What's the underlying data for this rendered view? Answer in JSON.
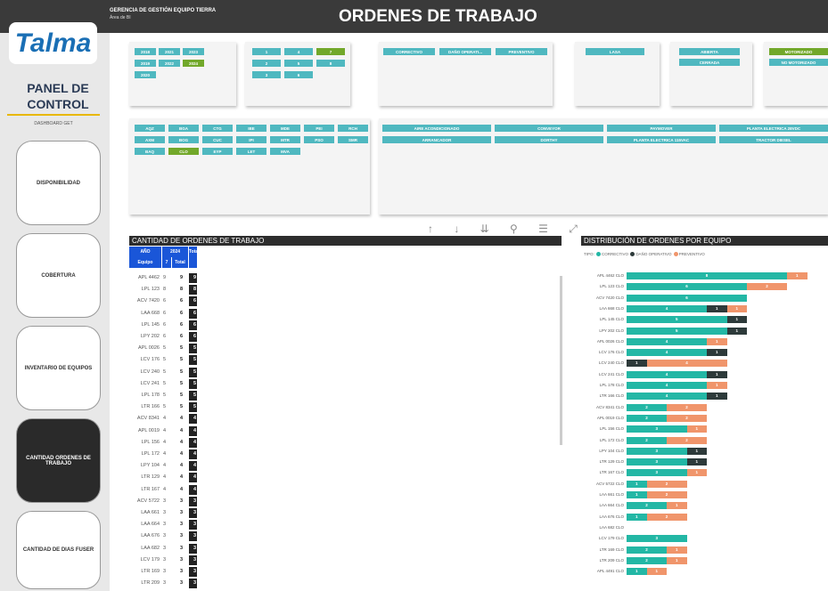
{
  "header": {
    "dept": "GERENCIA DE GESTIÓN EQUIPO TIERRA",
    "area": "Área de BI",
    "title": "ORDENES DE TRABAJO"
  },
  "sidebar": {
    "logo": "Talma",
    "panel_title": "PANEL DE CONTROL",
    "panel_sub": "DASHBOARD GET",
    "items": [
      {
        "label": "DISPONIBILIDAD",
        "active": false
      },
      {
        "label": "COBERTURA",
        "active": false
      },
      {
        "label": "INVENTARIO DE EQUIPOS",
        "active": false
      },
      {
        "label": "CANTIDAD ORDENES DE TRABAJO",
        "active": true
      },
      {
        "label": "CANTIDAD DE DIAS FUSER",
        "active": false
      }
    ]
  },
  "filters": {
    "years": [
      {
        "label": "2018",
        "sel": false
      },
      {
        "label": "2021",
        "sel": false
      },
      {
        "label": "2023",
        "sel": false
      },
      {
        "label": "2019",
        "sel": false
      },
      {
        "label": "2022",
        "sel": false
      },
      {
        "label": "2024",
        "sel": true
      },
      {
        "label": "2020",
        "sel": false
      }
    ],
    "months": [
      {
        "label": "1",
        "sel": false
      },
      {
        "label": "4",
        "sel": false
      },
      {
        "label": "7",
        "sel": true
      },
      {
        "label": "2",
        "sel": false
      },
      {
        "label": "5",
        "sel": false
      },
      {
        "label": "8",
        "sel": false
      },
      {
        "label": "3",
        "sel": false
      },
      {
        "label": "6",
        "sel": false
      }
    ],
    "tipo": [
      "CORRECTIVO",
      "DAÑO OPERATI...",
      "PREVENTIVO"
    ],
    "lasa": [
      "LASA"
    ],
    "estado": [
      "ABIERTA",
      "CERRADA"
    ],
    "motor": [
      {
        "label": "MOTORIZADO",
        "sel": true
      },
      {
        "label": "NO MOTORIZADO",
        "sel": false
      }
    ],
    "stations": [
      {
        "label": "AQZ",
        "sel": false
      },
      {
        "label": "BGA",
        "sel": false
      },
      {
        "label": "CTG",
        "sel": false
      },
      {
        "label": "IBE",
        "sel": false
      },
      {
        "label": "MDE",
        "sel": false
      },
      {
        "label": "PEI",
        "sel": false
      },
      {
        "label": "RCH",
        "sel": false
      },
      {
        "label": "AXM",
        "sel": false
      },
      {
        "label": "BOG",
        "sel": false
      },
      {
        "label": "CUC",
        "sel": false
      },
      {
        "label": "IPI",
        "sel": false
      },
      {
        "label": "MTR",
        "sel": false
      },
      {
        "label": "PSO",
        "sel": false
      },
      {
        "label": "SMR",
        "sel": false
      },
      {
        "label": "BAQ",
        "sel": false
      },
      {
        "label": "CLO",
        "sel": true
      },
      {
        "label": "EYP",
        "sel": false
      },
      {
        "label": "LET",
        "sel": false
      },
      {
        "label": "MVA",
        "sel": false
      }
    ],
    "equipment_types": [
      "AIRE ACONDICIONADO",
      "CONVEYOR",
      "PAYMOVER",
      "PLANTA ELECTRICA 28VDC",
      "ARRANCADOR",
      "DORTHY",
      "PLANTA ELECTRICA 115VAC",
      "TRACTOR DIESEL"
    ]
  },
  "toolbar": {
    "icons": "↑ ↓ ⇊ ⚲ ☰ ⤢"
  },
  "table": {
    "title": "CANTIDAD DE ORDENES DE TRABAJO",
    "hdr_year": "AÑO",
    "hdr_year_val": "2024",
    "hdr_total": "Total",
    "hdr_equipo": "Equipo",
    "hdr_month": "7",
    "hdr_total2": "Total",
    "rows": [
      [
        "APL 4462",
        "9",
        "9",
        "9"
      ],
      [
        "LPL 123",
        "8",
        "8",
        "8"
      ],
      [
        "ACV 7420",
        "6",
        "6",
        "6"
      ],
      [
        "LAA 668",
        "6",
        "6",
        "6"
      ],
      [
        "LPL 145",
        "6",
        "6",
        "6"
      ],
      [
        "LPY 202",
        "6",
        "6",
        "6"
      ],
      [
        "APL 0026",
        "5",
        "5",
        "5"
      ],
      [
        "LCV 176",
        "5",
        "5",
        "5"
      ],
      [
        "LCV 240",
        "5",
        "5",
        "5"
      ],
      [
        "LCV 241",
        "5",
        "5",
        "5"
      ],
      [
        "LPL 178",
        "5",
        "5",
        "5"
      ],
      [
        "LTR 166",
        "5",
        "5",
        "5"
      ],
      [
        "ACV 8341",
        "4",
        "4",
        "4"
      ],
      [
        "APL 0019",
        "4",
        "4",
        "4"
      ],
      [
        "LPL 156",
        "4",
        "4",
        "4"
      ],
      [
        "LPL 172",
        "4",
        "4",
        "4"
      ],
      [
        "LPY 104",
        "4",
        "4",
        "4"
      ],
      [
        "LTR 129",
        "4",
        "4",
        "4"
      ],
      [
        "LTR 167",
        "4",
        "4",
        "4"
      ],
      [
        "ACV 5722",
        "3",
        "3",
        "3"
      ],
      [
        "LAA 661",
        "3",
        "3",
        "3"
      ],
      [
        "LAA 664",
        "3",
        "3",
        "3"
      ],
      [
        "LAA 676",
        "3",
        "3",
        "3"
      ],
      [
        "LAA 682",
        "3",
        "3",
        "3"
      ],
      [
        "LCV 179",
        "3",
        "3",
        "3"
      ],
      [
        "LTR 169",
        "3",
        "3",
        "3"
      ],
      [
        "LTR 209",
        "3",
        "3",
        "3"
      ]
    ]
  },
  "chart_data": {
    "type": "bar",
    "title": "DISTRIBUCIÓN DE ORDENES POR EQUIPO",
    "legend_title": "TIPO",
    "legend": [
      "CORRECTIVO",
      "DAÑO OPERATIVO",
      "PREVENTIVO"
    ],
    "colors": {
      "CORRECTIVO": "#23b7a5",
      "DAÑO OPERATIVO": "#2d3a3a",
      "PREVENTIVO": "#f0956b"
    },
    "categories": [
      "APL 4462 CLO",
      "LPL 123 CLO",
      "ACV 7420 CLO",
      "LAA 668 CLO",
      "LPL 145 CLO",
      "LPY 202 CLO",
      "APL 0026 CLO",
      "LCV 176 CLO",
      "LCV 240 CLO",
      "LCV 241 CLO",
      "LPL 178 CLO",
      "LTR 166 CLO",
      "ACV 8341 CLO",
      "APL 0019 CLO",
      "LPL 156 CLO",
      "LPL 172 CLO",
      "LPY 104 CLO",
      "LTR 129 CLO",
      "LTR 167 CLO",
      "ACV 5722 CLO",
      "LAA 661 CLO",
      "LAA 664 CLO",
      "LAA 676 CLO",
      "LAA 682 CLO",
      "LCV 179 CLO",
      "LTR 169 CLO",
      "LTR 209 CLO",
      "APL 4491 CLO"
    ],
    "series": [
      {
        "name": "CORRECTIVO",
        "values": [
          8,
          6,
          6,
          4,
          5,
          5,
          4,
          4,
          0,
          4,
          4,
          4,
          2,
          2,
          3,
          2,
          3,
          3,
          3,
          1,
          1,
          2,
          1,
          0,
          3,
          2,
          2,
          1
        ]
      },
      {
        "name": "DAÑO OPERATIVO",
        "values": [
          0,
          0,
          0,
          1,
          1,
          1,
          0,
          1,
          1,
          1,
          0,
          1,
          0,
          0,
          0,
          0,
          1,
          1,
          0,
          0,
          0,
          0,
          0,
          0,
          0,
          0,
          0,
          0
        ]
      },
      {
        "name": "PREVENTIVO",
        "values": [
          1,
          2,
          0,
          1,
          0,
          0,
          1,
          0,
          4,
          0,
          1,
          0,
          2,
          2,
          1,
          2,
          0,
          0,
          1,
          2,
          2,
          1,
          2,
          0,
          0,
          1,
          1,
          1
        ]
      }
    ]
  }
}
